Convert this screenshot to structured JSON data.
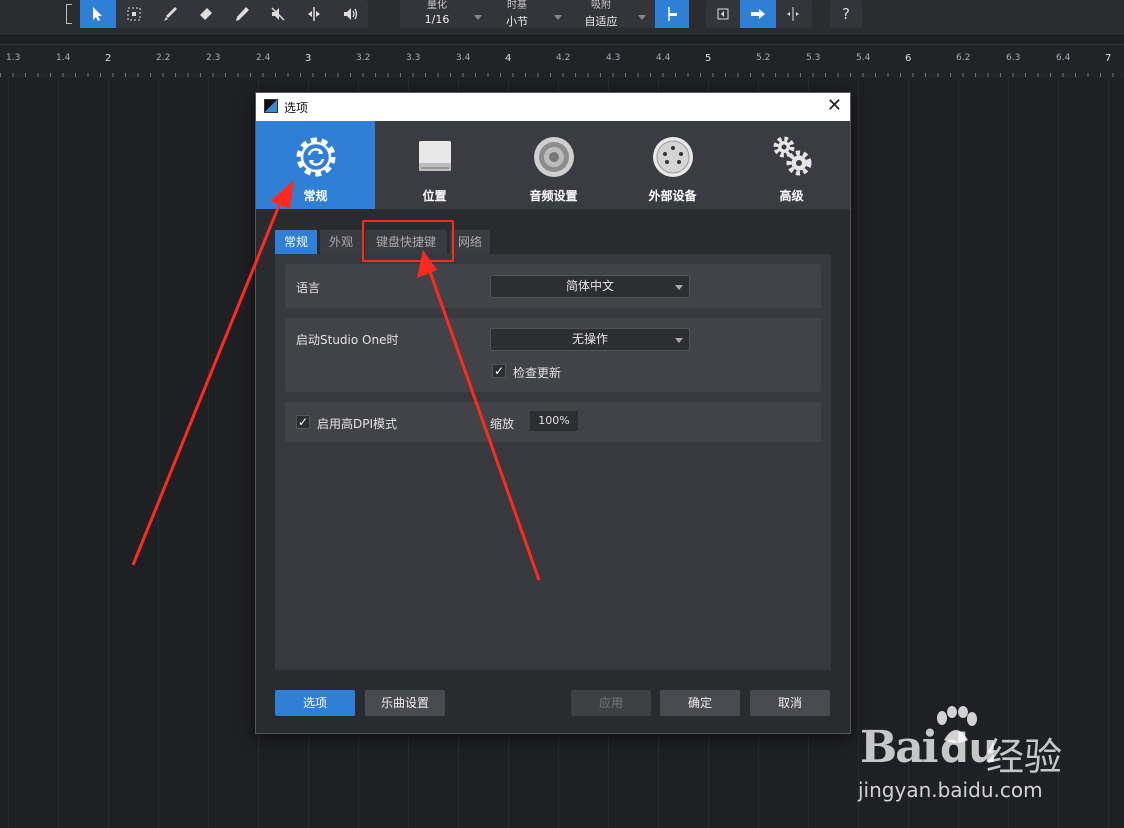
{
  "toolbar": {
    "tools": [
      "arrow-tool-icon",
      "range-tool-icon",
      "paint-tool-icon",
      "eraser-tool-icon",
      "pencil-tool-icon",
      "mute-tool-icon",
      "split-tool-icon",
      "listen-tool-icon"
    ],
    "quantize": {
      "label": "量化",
      "value": "1/16"
    },
    "timebase": {
      "label": "时基",
      "value": "小节"
    },
    "snap": {
      "label": "吸附",
      "value": "自适应"
    },
    "help_label": "?"
  },
  "ruler": {
    "labels": [
      "1.3",
      "1.4",
      "2",
      "2.2",
      "2.3",
      "2.4",
      "3",
      "3.2",
      "3.3",
      "3.4",
      "4",
      "4.2",
      "4.3",
      "4.4",
      "5",
      "5.2",
      "5.3",
      "5.4",
      "6",
      "6.2",
      "6.3",
      "6.4",
      "7"
    ]
  },
  "dialog": {
    "title": "选项",
    "close_label": "✕",
    "categories": [
      {
        "label": "常规",
        "icon": "gear-sync-icon"
      },
      {
        "label": "位置",
        "icon": "drive-icon"
      },
      {
        "label": "音频设置",
        "icon": "speaker-icon"
      },
      {
        "label": "外部设备",
        "icon": "midi-connector-icon"
      },
      {
        "label": "高级",
        "icon": "gears-icon"
      }
    ],
    "tabs": [
      "常规",
      "外观",
      "键盘快捷键",
      "网络"
    ],
    "settings": {
      "language_label": "语言",
      "language_value": "简体中文",
      "startup_label": "启动Studio One时",
      "startup_value": "无操作",
      "check_update_label": "检查更新",
      "check_update_checked": "✓",
      "high_dpi_label": "启用高DPI模式",
      "high_dpi_checked": "✓",
      "zoom_label": "缩放",
      "zoom_value": "100%"
    },
    "buttons": {
      "options": "选项",
      "song_settings": "乐曲设置",
      "apply": "应用",
      "ok": "确定",
      "cancel": "取消"
    }
  },
  "colors": {
    "accent": "#2f7fd6",
    "annotation": "#ff2a1f"
  },
  "watermark": {
    "brand_a": "Bai",
    "brand_b": "du",
    "brand_c": "经验",
    "url": "jingyan.baidu.com"
  }
}
